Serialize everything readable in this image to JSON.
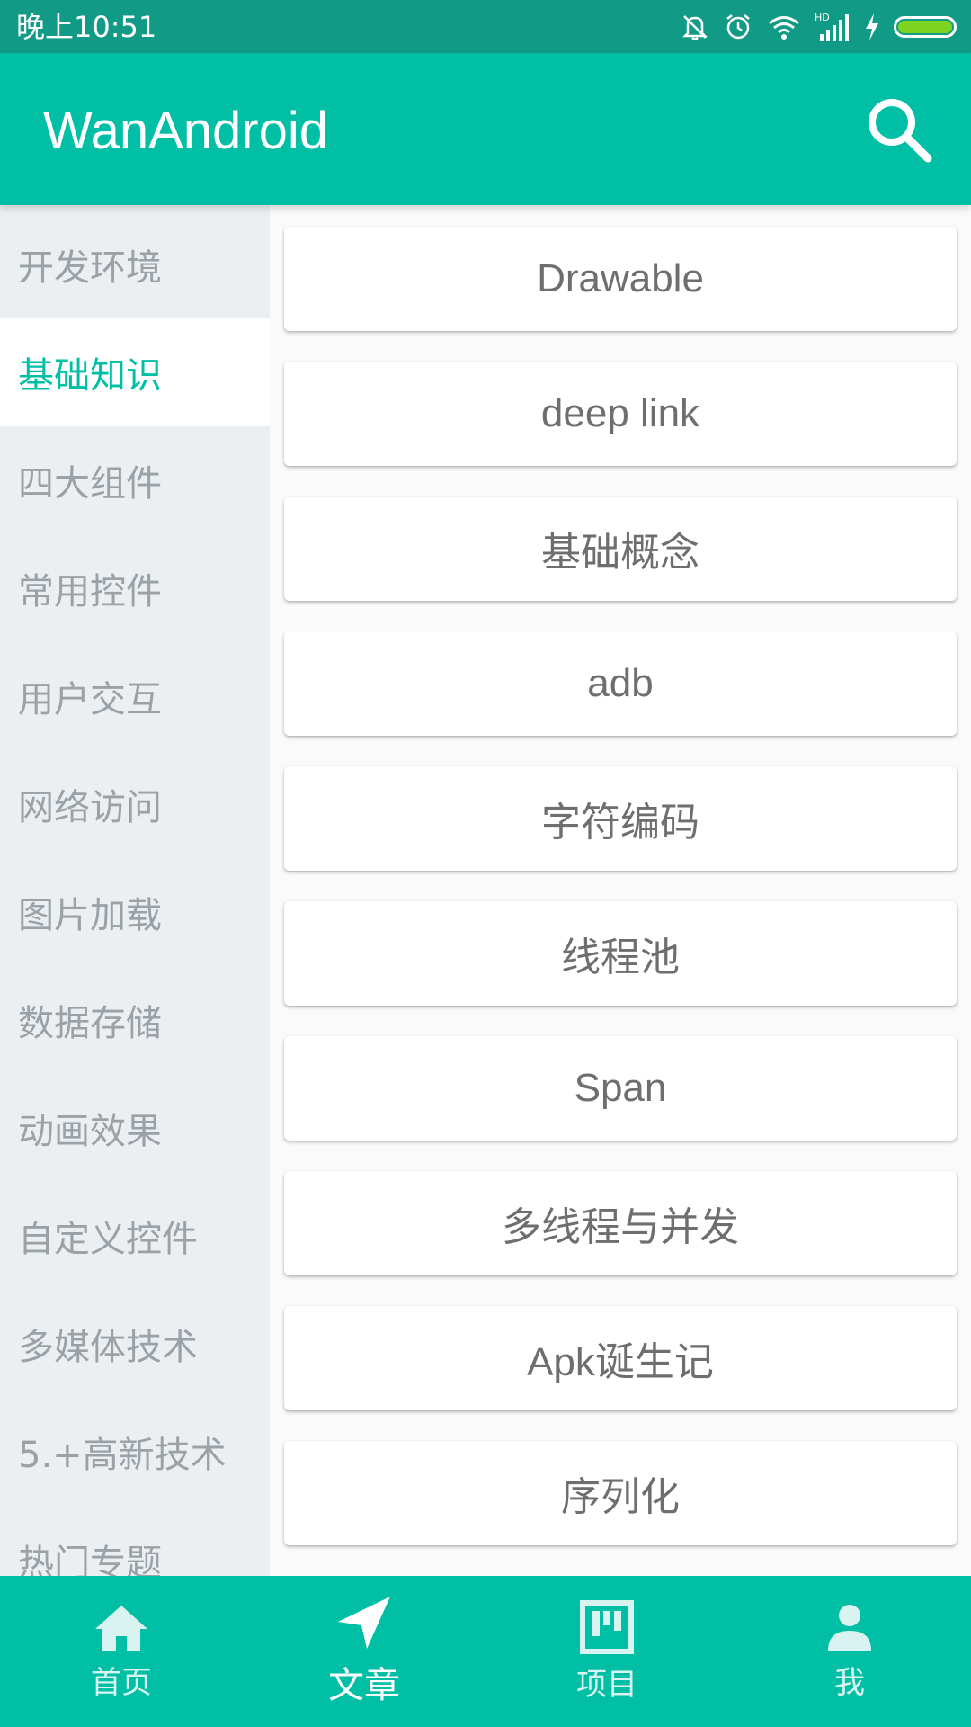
{
  "status_bar": {
    "time": "晚上10:51",
    "icons": [
      "mute-icon",
      "alarm-icon",
      "wifi-icon",
      "hd-signal-icon",
      "charging-icon",
      "battery-icon"
    ],
    "hd_label": "HD"
  },
  "app_bar": {
    "title": "WanAndroid",
    "search_icon": "search-icon"
  },
  "sidebar": {
    "items": [
      {
        "label": "开发环境",
        "active": false
      },
      {
        "label": "基础知识",
        "active": true
      },
      {
        "label": "四大组件",
        "active": false
      },
      {
        "label": "常用控件",
        "active": false
      },
      {
        "label": "用户交互",
        "active": false
      },
      {
        "label": "网络访问",
        "active": false
      },
      {
        "label": "图片加载",
        "active": false
      },
      {
        "label": "数据存储",
        "active": false
      },
      {
        "label": "动画效果",
        "active": false
      },
      {
        "label": "自定义控件",
        "active": false
      },
      {
        "label": "多媒体技术",
        "active": false
      },
      {
        "label": "5.+高新技术",
        "active": false
      },
      {
        "label": "热门专题",
        "active": false
      }
    ]
  },
  "content": {
    "cards": [
      "Drawable",
      "deep link",
      "基础概念",
      "adb",
      "字符编码",
      "线程池",
      "Span",
      "多线程与并发",
      "Apk诞生记",
      "序列化"
    ]
  },
  "bottom_nav": {
    "items": [
      {
        "label": "首页",
        "icon": "home-icon",
        "active": false
      },
      {
        "label": "文章",
        "icon": "navigation-arrow-icon",
        "active": true
      },
      {
        "label": "项目",
        "icon": "board-icon",
        "active": false
      },
      {
        "label": "我",
        "icon": "person-icon",
        "active": false
      }
    ]
  },
  "colors": {
    "status_bar": "#119a86",
    "primary": "#00bfa5",
    "sidebar_bg": "#eceff1",
    "sidebar_text": "#9aa2a8",
    "card_text": "#6e6e6e",
    "battery": "#7ed321"
  }
}
